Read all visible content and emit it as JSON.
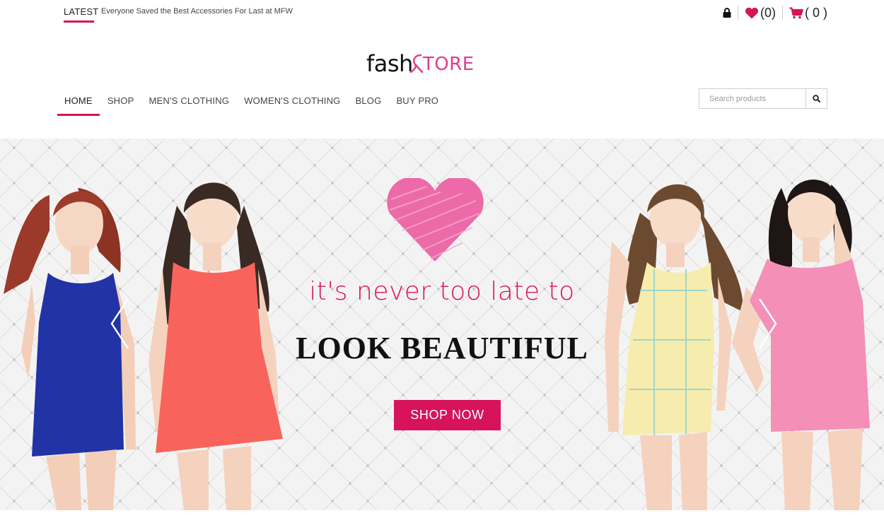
{
  "topbar": {
    "latest_label": "LATEST",
    "latest_text": "Everyone Saved the Best Accessories For Last at MFW",
    "wishlist_count": "(0)",
    "cart_count": "( 0 )",
    "lock_icon": "lock-icon",
    "heart_icon": "heart-icon",
    "cart_icon": "cart-icon"
  },
  "logo": {
    "part1": "fash",
    "part2": "TORE"
  },
  "nav": {
    "items": [
      {
        "label": "HOME",
        "active": true
      },
      {
        "label": "SHOP"
      },
      {
        "label": "MEN'S CLOTHING"
      },
      {
        "label": "WOMEN'S CLOTHING"
      },
      {
        "label": "BLOG"
      },
      {
        "label": "BUY PRO"
      }
    ]
  },
  "search": {
    "placeholder": "Search products",
    "icon": "search-icon"
  },
  "hero": {
    "subtitle": "it's never too late to",
    "title": "LOOK BEAUTIFUL",
    "button": "SHOP NOW",
    "prev_icon": "chevron-left-icon",
    "next_icon": "chevron-right-icon"
  },
  "colors": {
    "accent": "#d6135b",
    "logo_pink": "#e23d8a",
    "heart_pink": "#e8559c",
    "dress_blue": "#2233a6",
    "dress_coral": "#f8645c",
    "dress_yellow": "#f6ecae",
    "dress_pink": "#f48fb8"
  }
}
